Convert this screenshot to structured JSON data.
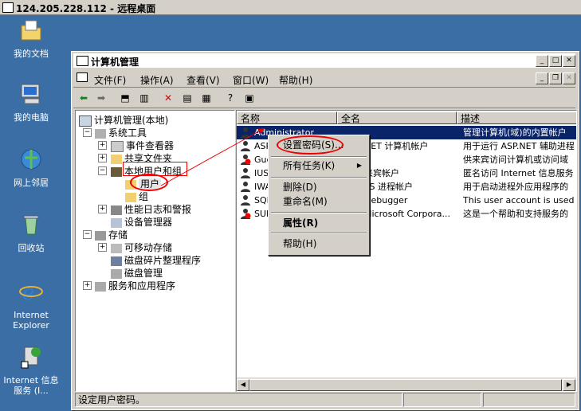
{
  "rdp": {
    "title": "124.205.228.112 - 远程桌面"
  },
  "desktop": {
    "icons": [
      {
        "label": "我的文档",
        "icon": "documents-icon"
      },
      {
        "label": "我的电脑",
        "icon": "computer-icon"
      },
      {
        "label": "网上邻居",
        "icon": "network-icon"
      },
      {
        "label": "回收站",
        "icon": "recycle-bin-icon"
      },
      {
        "label": "Internet Explorer",
        "icon": "ie-icon"
      },
      {
        "label": "Internet 信息服务 (I...",
        "icon": "iis-icon"
      }
    ]
  },
  "window": {
    "title": "计算机管理",
    "menus": [
      "文件(F)",
      "操作(A)",
      "查看(V)",
      "窗口(W)",
      "帮助(H)"
    ],
    "tree": {
      "root": "计算机管理(本地)",
      "system_tools": "系统工具",
      "event_viewer": "事件查看器",
      "shared_folders": "共享文件夹",
      "local_users": "本地用户和组",
      "users": "用户",
      "groups": "组",
      "perf_logs": "性能日志和警报",
      "device_manager": "设备管理器",
      "storage": "存储",
      "removable": "可移动存储",
      "defrag": "磁盘碎片整理程序",
      "disk_mgmt": "磁盘管理",
      "services_apps": "服务和应用程序"
    },
    "columns": {
      "name": "名称",
      "fullname": "全名",
      "desc": "描述"
    },
    "rows": [
      {
        "name": "Administrator",
        "fullname": "",
        "desc": "管理计算机(域)的内置帐户"
      },
      {
        "name": "ASP",
        "fullname": "NET 计算机帐户",
        "desc": "用于运行 ASP.NET 辅助进程"
      },
      {
        "name": "Gue",
        "fullname": "",
        "desc": "供来宾访问计算机或访问域"
      },
      {
        "name": "IUS",
        "fullname": "来宾帐户",
        "desc": "匿名访问 Internet 信息服务"
      },
      {
        "name": "IWA",
        "fullname": "IIS 进程帐户",
        "desc": "用于启动进程外应用程序的"
      },
      {
        "name": "SQL",
        "fullname": "Debugger",
        "desc": "This user account is used"
      },
      {
        "name": "SUP",
        "fullname": "Microsoft Corpora...",
        "desc": "这是一个帮助和支持服务的"
      }
    ],
    "context_menu": {
      "set_password": "设置密码(S)...",
      "all_tasks": "所有任务(K)",
      "delete": "删除(D)",
      "rename": "重命名(M)",
      "properties": "属性(R)",
      "help": "帮助(H)"
    },
    "status": "设定用户密码。"
  },
  "colors": {
    "desktop": "#3a6ea5",
    "selection": "#0a246a",
    "annotation": "#e00000"
  }
}
